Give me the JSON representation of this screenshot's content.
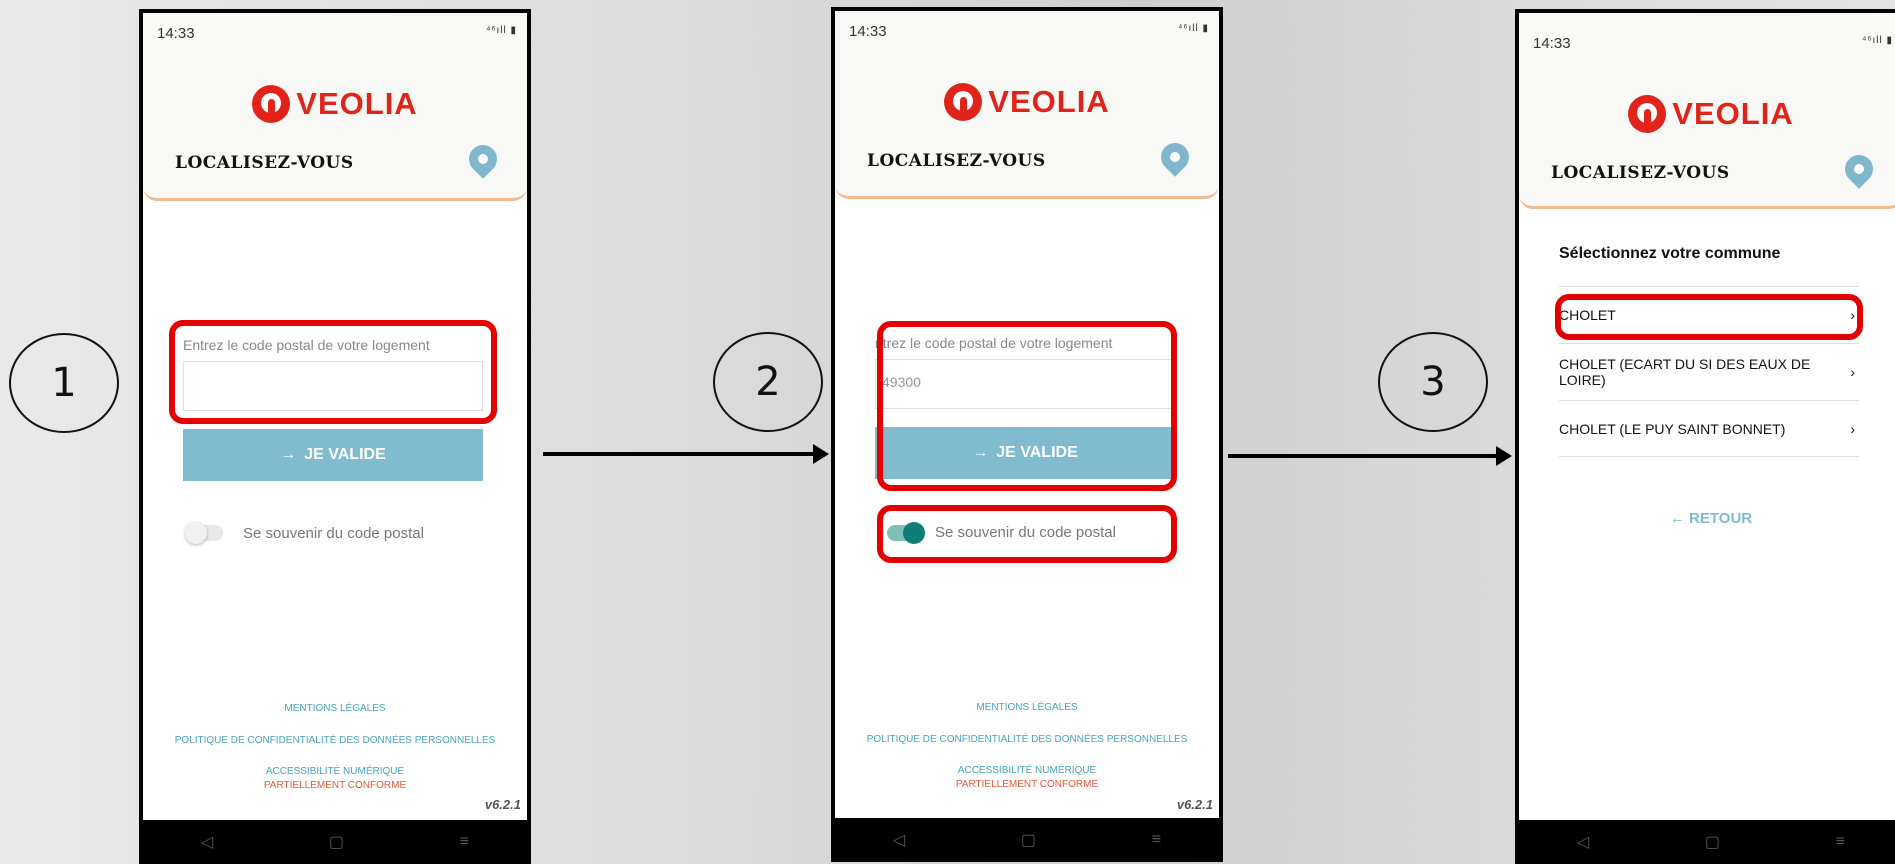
{
  "steps": [
    "1",
    "2",
    "3"
  ],
  "status_time": "14:33",
  "status_icons": "⁴⁶ıll ▮",
  "brand": "VEOLIA",
  "header_title": "LOCALISEZ-VOUS",
  "postal_label_full": "Entrez le code postal de votre logement",
  "postal_label_scrolled": "ntrez le code postal de votre logement",
  "postal_value": "49300",
  "validate_label": "JE VALIDE",
  "remember_label": "Se souvenir du code postal",
  "footer": {
    "legal": "MENTIONS LÉGALES",
    "privacy": "POLITIQUE DE CONFIDENTIALITÉ DES DONNÉES PERSONNELLES",
    "accessibility": "ACCESSIBILITÉ NUMÉRIQUE",
    "conformity": "PARTIELLEMENT CONFORME"
  },
  "version": "v6.2.1",
  "select_title": "Sélectionnez votre commune",
  "communes": [
    "CHOLET",
    "CHOLET (ECART DU SI DES EAUX DE LOIRE)",
    "CHOLET (LE PUY SAINT BONNET)"
  ],
  "back_label": "RETOUR",
  "nav": {
    "back": "◁",
    "home": "▢",
    "menu": "≡"
  },
  "colors": {
    "brand_red": "#e2231a",
    "accent_blue": "#80bccd",
    "toggle_on": "#0d7d76",
    "highlight": "#e30000"
  }
}
